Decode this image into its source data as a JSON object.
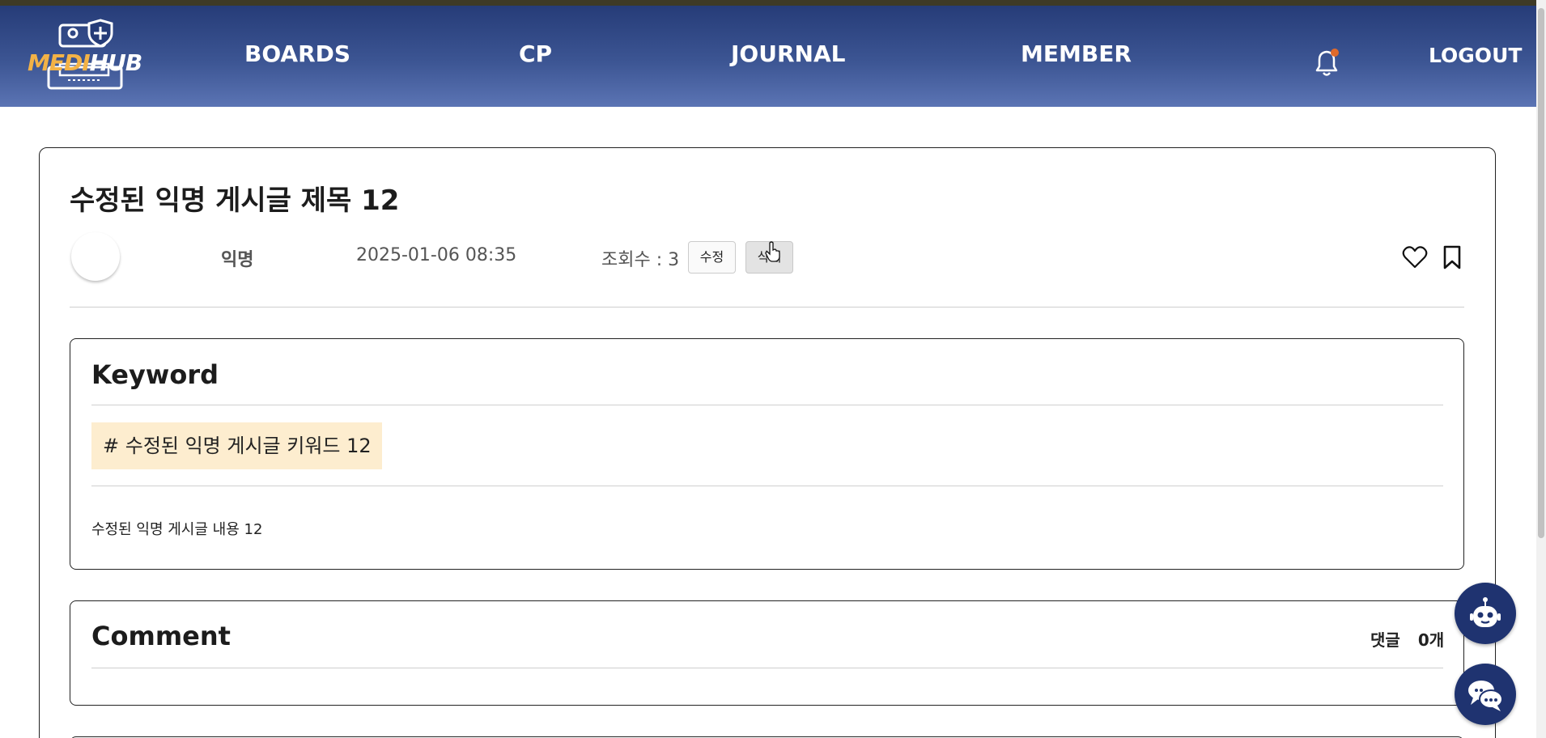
{
  "header": {
    "logo": {
      "part1": "MEDI",
      "part2": "HUB"
    },
    "nav": [
      {
        "label": "BOARDS"
      },
      {
        "label": "CP"
      },
      {
        "label": "JOURNAL"
      },
      {
        "label": "MEMBER"
      }
    ],
    "bell_icon": "bell-icon",
    "logout_label": "LOGOUT"
  },
  "post": {
    "title": "수정된 익명 게시글 제목 12",
    "author": "익명",
    "date": "2025-01-06 08:35",
    "views": "조회수 : 3",
    "edit_label": "수정",
    "delete_label": "삭제",
    "like_icon": "heart-icon",
    "bookmark_icon": "bookmark-icon"
  },
  "keyword_section": {
    "heading": "Keyword",
    "tag": "# 수정된 익명 게시글 키워드 12",
    "content": "수정된 익명 게시글 내용 12"
  },
  "comment_section": {
    "heading": "Comment",
    "count_label": "댓글",
    "count_value": "0개"
  },
  "floating": {
    "chatbot_icon": "robot-icon",
    "chat_icon": "chat-bubbles-icon"
  },
  "colors": {
    "nav_gradient_top": "#263c78",
    "nav_gradient_bottom": "#5b74b4",
    "logo_accent": "#f3b246",
    "keyword_tag_bg": "#fdedcf",
    "fab_bg": "#1f3370",
    "bell_dot": "#e06a2a"
  }
}
